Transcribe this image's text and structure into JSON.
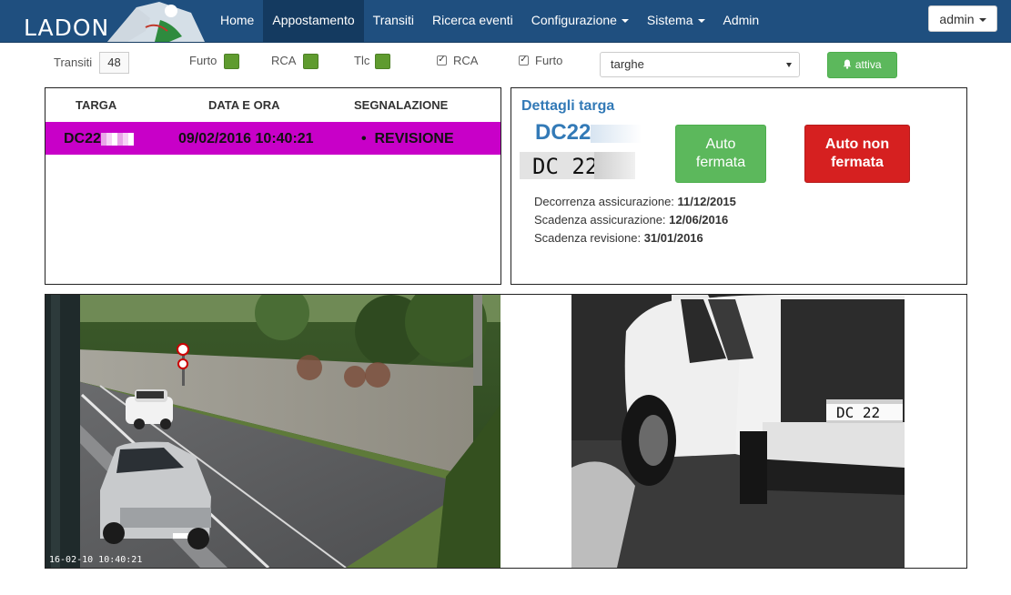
{
  "brand": {
    "name": "LADON"
  },
  "nav": {
    "items": [
      {
        "label": "Home",
        "active": false,
        "dropdown": false
      },
      {
        "label": "Appostamento",
        "active": true,
        "dropdown": false
      },
      {
        "label": "Transiti",
        "active": false,
        "dropdown": false
      },
      {
        "label": "Ricerca eventi",
        "active": false,
        "dropdown": false
      },
      {
        "label": "Configurazione",
        "active": false,
        "dropdown": true
      },
      {
        "label": "Sistema",
        "active": false,
        "dropdown": true
      },
      {
        "label": "Admin",
        "active": false,
        "dropdown": false
      }
    ],
    "user": "admin"
  },
  "toolbar": {
    "transiti_label": "Transiti",
    "transiti_count": "48",
    "indicators": [
      "Furto",
      "RCA",
      "Tlc"
    ],
    "checkboxes": [
      {
        "label": "RCA",
        "checked": true
      },
      {
        "label": "Furto",
        "checked": true
      }
    ],
    "select_value": "targhe",
    "activate_label": "attiva",
    "activate_icon": "bell-icon"
  },
  "events_table": {
    "headers": [
      "TARGA",
      "DATA E ORA",
      "SEGNALAZIONE"
    ],
    "rows": [
      {
        "targa": "DC22",
        "datetime": "09/02/2016 10:40:21",
        "segnalazione": "REVISIONE",
        "highlight": "#c800c8"
      }
    ]
  },
  "details": {
    "title": "Dettagli targa",
    "plate": "DC22",
    "plate_image_text": "DC 22",
    "btn_stopped": {
      "line1": "Auto",
      "line2": "fermata"
    },
    "btn_not_stopped": {
      "line1": "Auto non",
      "line2": "fermata"
    },
    "info": [
      {
        "label": "Decorrenza assicurazione:",
        "value": "11/12/2015"
      },
      {
        "label": "Scadenza assicurazione:",
        "value": "12/06/2016"
      },
      {
        "label": "Scadenza revisione:",
        "value": "31/01/2016"
      }
    ]
  },
  "cameras": {
    "context_timestamp": "16-02-10 10:40:21",
    "plate_text": "DC 22"
  },
  "colors": {
    "navbar": "#1f4f7f",
    "nav_active": "#143a60",
    "highlight_row": "#c800c8",
    "green": "#5cb85c",
    "red": "#d62020",
    "accent": "#337ab7"
  }
}
